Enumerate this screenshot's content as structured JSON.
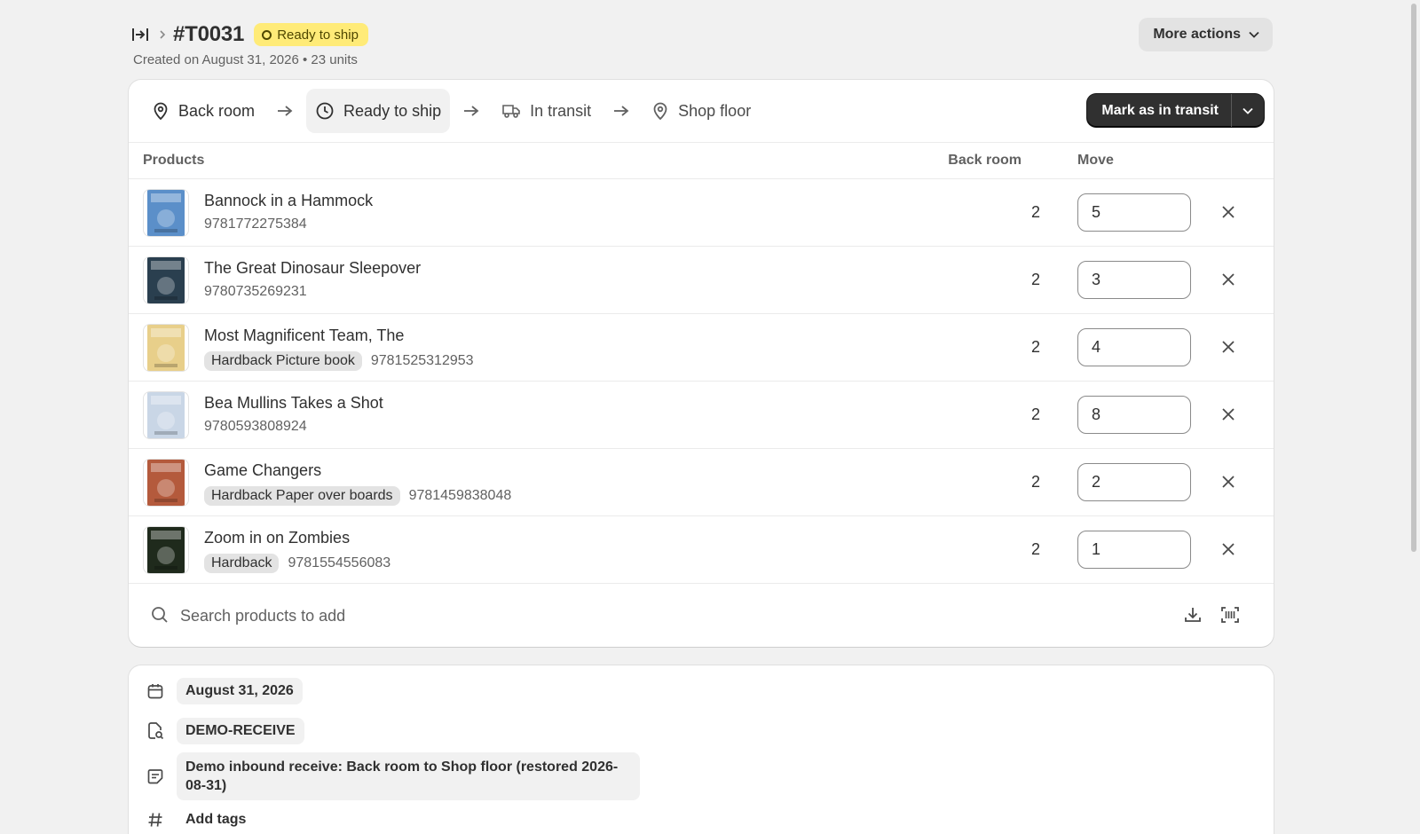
{
  "header": {
    "title": "#T0031",
    "status": "Ready to ship",
    "subtitle": "Created on August 31, 2026 • 23 units",
    "more_actions": "More actions"
  },
  "steps": [
    {
      "label": "Back room",
      "icon": "location-pin-icon"
    },
    {
      "label": "Ready to ship",
      "icon": "clock-icon"
    },
    {
      "label": "In transit",
      "icon": "truck-icon"
    },
    {
      "label": "Shop floor",
      "icon": "location-pin-icon"
    }
  ],
  "primary_action": "Mark as in transit",
  "table": {
    "headers": {
      "products": "Products",
      "back_room": "Back room",
      "move": "Move"
    },
    "rows": [
      {
        "name": "Bannock in a Hammock",
        "format": "",
        "isbn": "9781772275384",
        "back_room": "2",
        "move": "5",
        "cover_color": "#5b8fc9"
      },
      {
        "name": "The Great Dinosaur Sleepover",
        "format": "",
        "isbn": "9780735269231",
        "back_room": "2",
        "move": "3",
        "cover_color": "#2a3f4f"
      },
      {
        "name": "Most Magnificent Team, The",
        "format": "Hardback Picture book",
        "isbn": "9781525312953",
        "back_room": "2",
        "move": "4",
        "cover_color": "#e8cf8a"
      },
      {
        "name": "Bea Mullins Takes a Shot",
        "format": "",
        "isbn": "9780593808924",
        "back_room": "2",
        "move": "8",
        "cover_color": "#c9d6e6"
      },
      {
        "name": "Game Changers",
        "format": "Hardback Paper over boards",
        "isbn": "9781459838048",
        "back_room": "2",
        "move": "2",
        "cover_color": "#b45a3c"
      },
      {
        "name": "Zoom in on Zombies",
        "format": "Hardback",
        "isbn": "9781554556083",
        "back_room": "2",
        "move": "1",
        "cover_color": "#1f2a1c"
      }
    ]
  },
  "search": {
    "placeholder": "Search products to add"
  },
  "meta": {
    "date": "August 31, 2026",
    "reference": "DEMO-RECEIVE",
    "note": "Demo inbound receive: Back room to Shop floor (restored 2026-08-31)",
    "tags": "Add tags"
  }
}
